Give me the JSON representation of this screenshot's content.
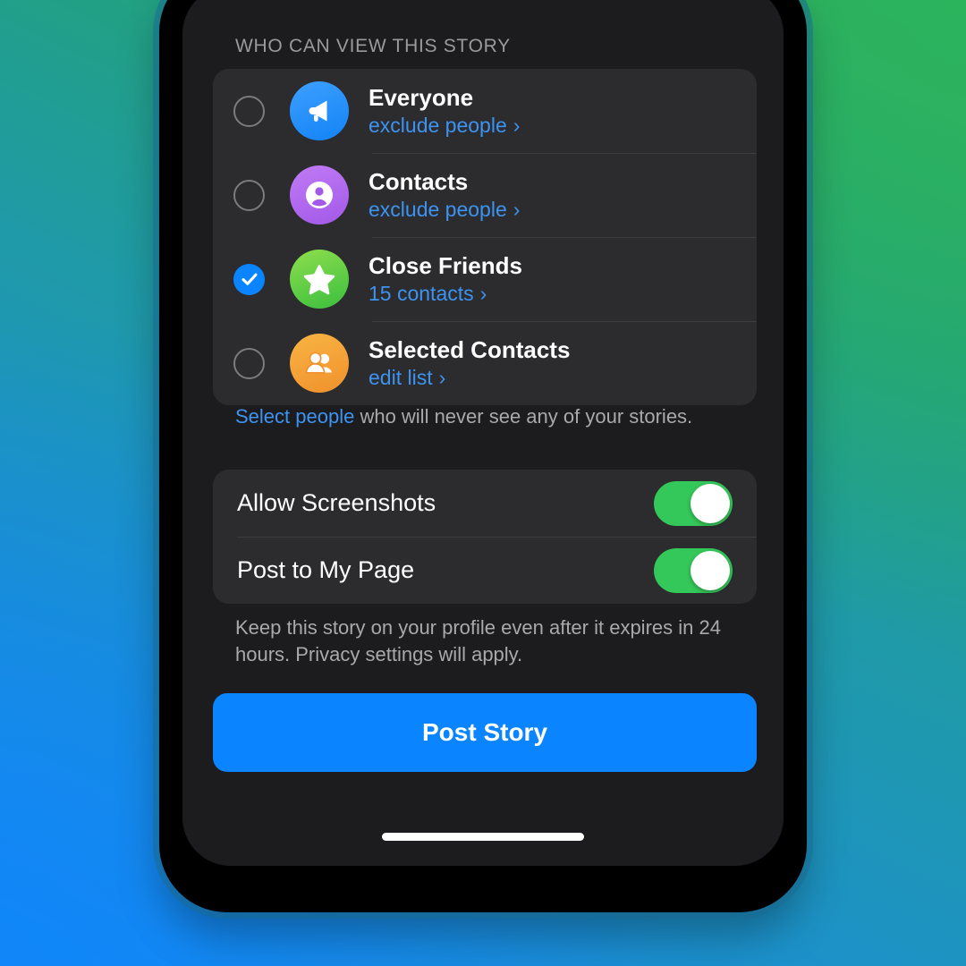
{
  "theme": {
    "accent_blue": "#0a84ff",
    "link_blue": "#3d93f2",
    "toggle_green": "#34c759",
    "card_bg": "#2c2c2e",
    "screen_bg": "#1c1c1e",
    "wallpaper_green": "#2fb15f",
    "wallpaper_teal": "#1f9aa8",
    "wallpaper_blue": "#1189f5"
  },
  "audience": {
    "header": "WHO CAN VIEW THIS STORY",
    "options": [
      {
        "title": "Everyone",
        "subtitle": "exclude people",
        "chevron": "›",
        "selected": false,
        "icon": "megaphone-icon",
        "icon_color": "#1283f5"
      },
      {
        "title": "Contacts",
        "subtitle": "exclude people",
        "chevron": "›",
        "selected": false,
        "icon": "person-circle-icon",
        "icon_color": "#a259e8"
      },
      {
        "title": "Close Friends",
        "subtitle": "15 contacts",
        "chevron": "›",
        "selected": true,
        "icon": "star-icon",
        "icon_color": "#3bbf3f"
      },
      {
        "title": "Selected Contacts",
        "subtitle": "edit list",
        "chevron": "›",
        "selected": false,
        "icon": "group-people-icon",
        "icon_color": "#f0912c"
      }
    ],
    "footnote_link": "Select people",
    "footnote_rest": " who will never see any of your stories."
  },
  "toggles": {
    "rows": [
      {
        "label": "Allow Screenshots",
        "on": true
      },
      {
        "label": "Post to My Page",
        "on": true
      }
    ],
    "footnote": "Keep this story on your profile even after it expires in 24 hours. Privacy settings will apply."
  },
  "actions": {
    "post_story_label": "Post Story"
  }
}
